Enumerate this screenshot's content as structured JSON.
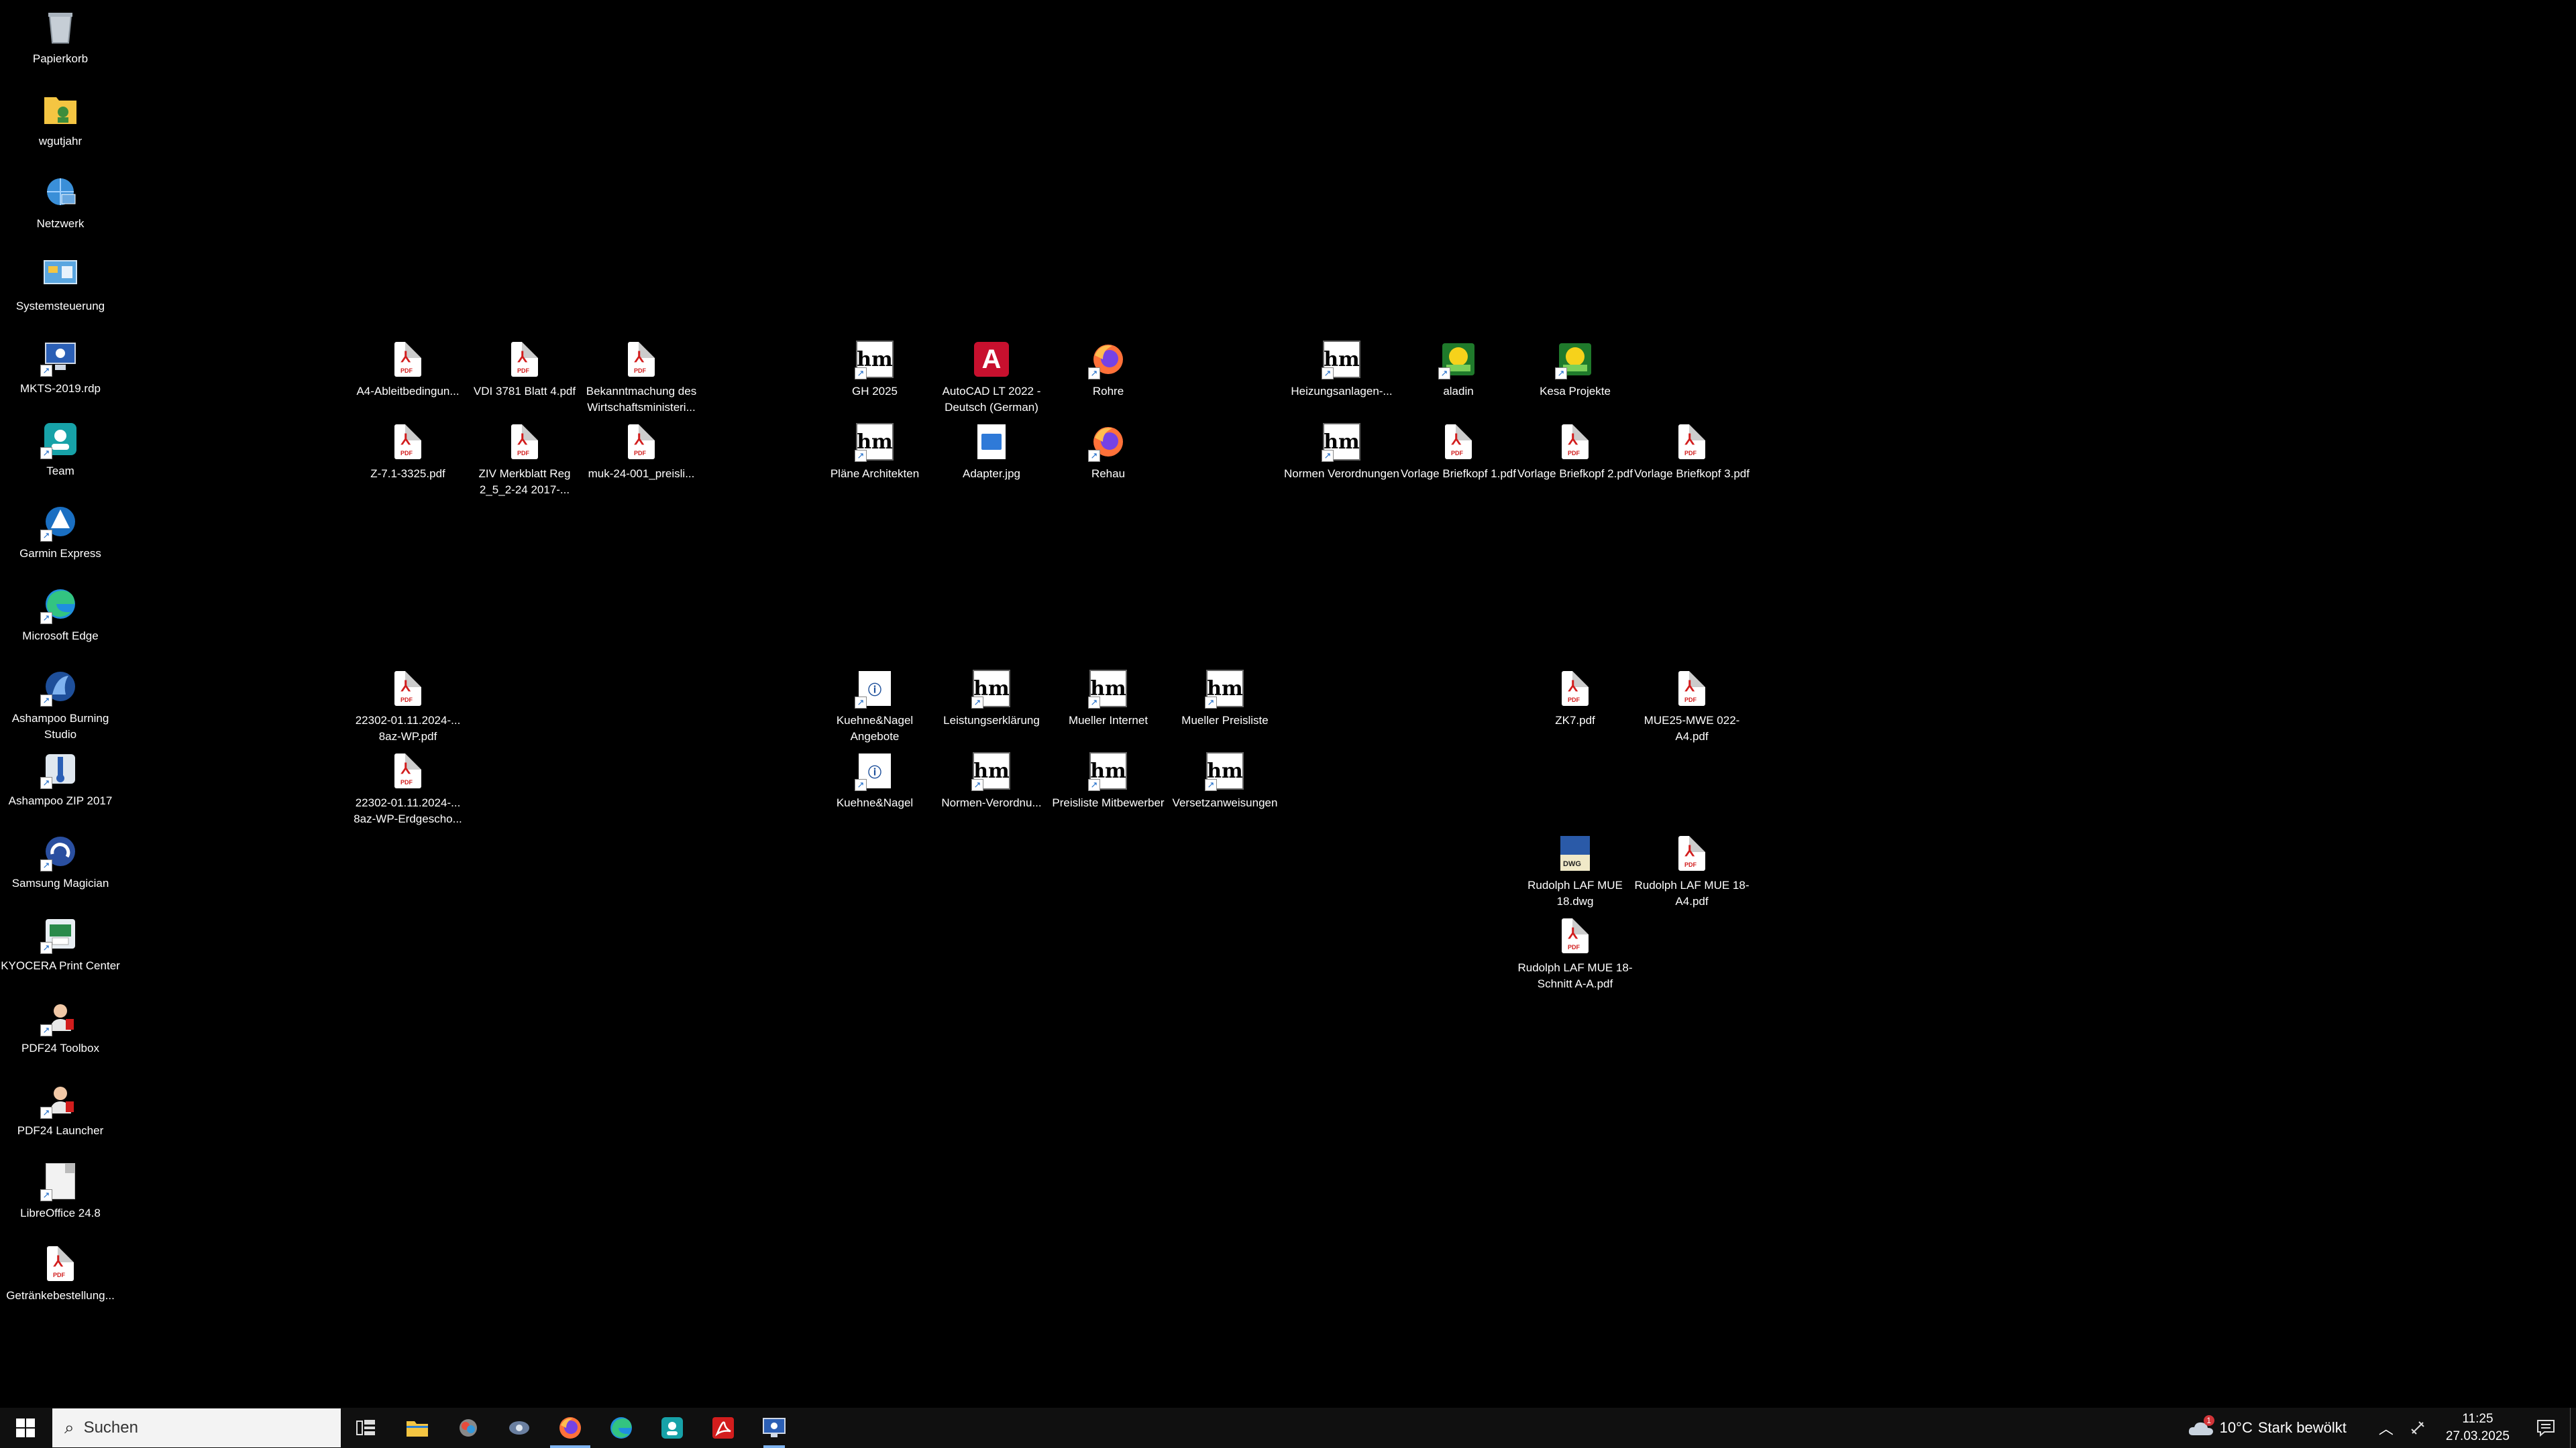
{
  "desktop": {
    "left_column": [
      {
        "label": "Papierkorb",
        "icon": "recycle-bin-icon"
      },
      {
        "label": "wgutjahr",
        "icon": "user-folder-icon"
      },
      {
        "label": "Netzwerk",
        "icon": "network-icon"
      },
      {
        "label": "Systemsteuerung",
        "icon": "control-panel-icon"
      },
      {
        "label": "MKTS-2019.rdp",
        "icon": "remote-desktop-icon"
      },
      {
        "label": "Team",
        "icon": "team-app-icon"
      },
      {
        "label": "Garmin Express",
        "icon": "garmin-icon"
      },
      {
        "label": "Microsoft Edge",
        "icon": "edge-icon"
      },
      {
        "label": "Ashampoo Burning Studio",
        "icon": "burning-studio-icon"
      },
      {
        "label": "Ashampoo ZIP 2017",
        "icon": "zip-icon"
      },
      {
        "label": "Samsung Magician",
        "icon": "samsung-magician-icon"
      },
      {
        "label": "KYOCERA Print Center",
        "icon": "kyocera-icon"
      },
      {
        "label": "PDF24 Toolbox",
        "icon": "pdf24-icon"
      },
      {
        "label": "PDF24 Launcher",
        "icon": "pdf24-icon"
      },
      {
        "label": "LibreOffice 24.8",
        "icon": "libreoffice-icon"
      },
      {
        "label": "Getränkebestellung...",
        "icon": "pdf-icon"
      }
    ],
    "group1": [
      {
        "label": "A4-Ableitbedingun...",
        "icon": "pdf-icon"
      },
      {
        "label": "VDI 3781 Blatt 4.pdf",
        "icon": "pdf-icon"
      },
      {
        "label": "Bekanntmachung des Wirtschaftsministeri...",
        "icon": "pdf-icon"
      },
      {
        "label": "Z-7.1-3325.pdf",
        "icon": "pdf-icon"
      },
      {
        "label": "ZIV Merkblatt Reg 2_5_2-24 2017-...",
        "icon": "pdf-icon"
      },
      {
        "label": "muk-24-001_preisli...",
        "icon": "pdf-icon"
      }
    ],
    "group2": [
      {
        "label": "GH 2025",
        "icon": "hm-folder-icon"
      },
      {
        "label": "AutoCAD LT 2022 - Deutsch (German)",
        "icon": "autocad-icon"
      },
      {
        "label": "Rohre",
        "icon": "firefox-shortcut-icon"
      },
      {
        "label": "Pläne Architekten",
        "icon": "hm-folder-icon"
      },
      {
        "label": "Adapter.jpg",
        "icon": "image-file-icon"
      },
      {
        "label": "Rehau",
        "icon": "firefox-shortcut-icon"
      }
    ],
    "group3": [
      {
        "label": "Heizungsanlagen-...",
        "icon": "hm-folder-icon"
      },
      {
        "label": "aladin",
        "icon": "aladin-icon"
      },
      {
        "label": "Kesa Projekte",
        "icon": "aladin-icon"
      },
      {
        "label": "Normen Verordnungen",
        "icon": "hm-folder-icon"
      },
      {
        "label": "Vorlage Briefkopf 1.pdf",
        "icon": "pdf-icon"
      },
      {
        "label": "Vorlage Briefkopf 2.pdf",
        "icon": "pdf-icon"
      },
      {
        "label": "Vorlage Briefkopf 3.pdf",
        "icon": "pdf-icon"
      }
    ],
    "group4": [
      {
        "label": "22302-01.11.2024-... 8az-WP.pdf",
        "icon": "pdf-icon"
      },
      {
        "label": "22302-01.11.2024-... 8az-WP-Erdgescho...",
        "icon": "pdf-icon"
      }
    ],
    "group5": [
      {
        "label": "Kuehne&Nagel Angebote",
        "icon": "document-shortcut-icon"
      },
      {
        "label": "Leistungserklärung",
        "icon": "hm-folder-icon"
      },
      {
        "label": "Mueller Internet",
        "icon": "hm-folder-icon"
      },
      {
        "label": "Mueller Preisliste",
        "icon": "hm-folder-icon"
      },
      {
        "label": "Kuehne&Nagel",
        "icon": "document-shortcut-icon"
      },
      {
        "label": "Normen-Verordnu...",
        "icon": "hm-folder-icon"
      },
      {
        "label": "Preisliste Mitbewerber",
        "icon": "hm-folder-icon"
      },
      {
        "label": "Versetzanweisungen",
        "icon": "hm-folder-icon"
      }
    ],
    "group6": [
      {
        "label": "ZK7.pdf",
        "icon": "pdf-icon"
      },
      {
        "label": "MUE25-MWE 022-A4.pdf",
        "icon": "pdf-icon"
      },
      {
        "label": "Rudolph LAF MUE 18.dwg",
        "icon": "dwg-file-icon"
      },
      {
        "label": "Rudolph LAF MUE 18-A4.pdf",
        "icon": "pdf-icon"
      },
      {
        "label": "Rudolph LAF MUE 18-Schnitt A-A.pdf",
        "icon": "pdf-icon"
      }
    ]
  },
  "taskbar": {
    "search_placeholder": "Suchen",
    "apps": [
      "task-view-icon",
      "file-explorer-icon",
      "app-icon",
      "app-icon",
      "firefox-icon",
      "edge-icon",
      "team-app-icon",
      "acrobat-icon",
      "remote-desktop-icon"
    ],
    "weather_temp": "10°C",
    "weather_text": "Stark bewölkt",
    "weather_badge": "1",
    "time": "11:25",
    "date": "27.03.2025"
  },
  "colors": {
    "desktop_bg": "#000000",
    "taskbar_bg": "#101010",
    "pdf_red": "#d21d1d",
    "accent": "#7fb3f0"
  }
}
